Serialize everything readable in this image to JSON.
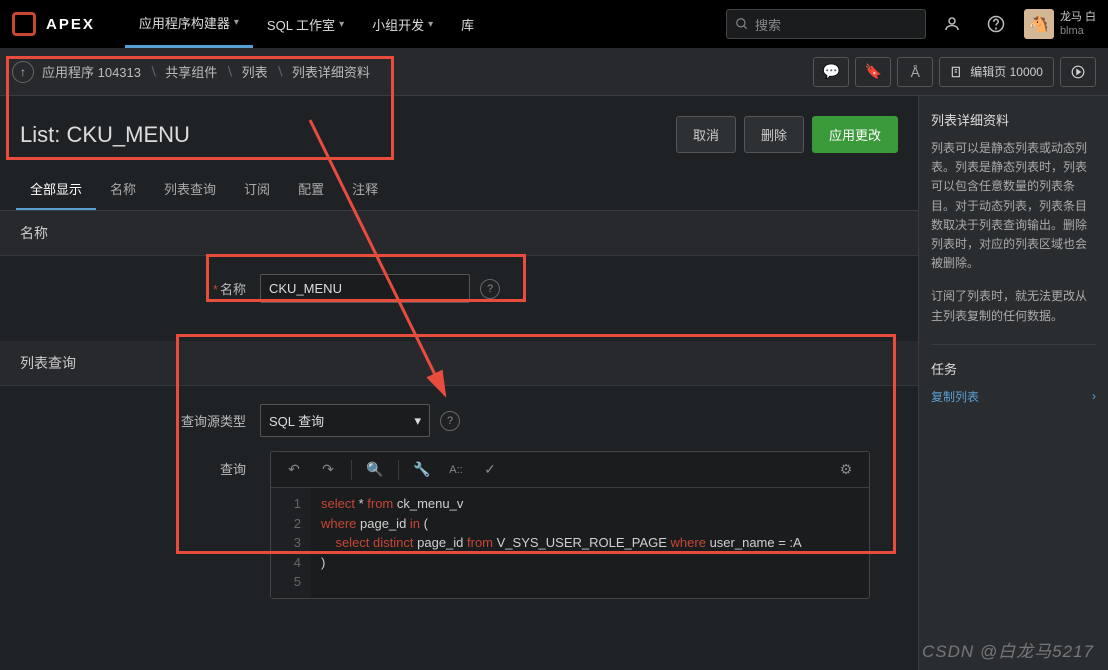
{
  "topnav": {
    "logo": "APEX",
    "items": [
      "应用程序构建器",
      "SQL 工作室",
      "小组开发",
      "库"
    ],
    "search_placeholder": "搜索",
    "user_name": "龙马 白",
    "user_id": "blma"
  },
  "breadcrumb": {
    "items": [
      "应用程序 104313",
      "共享组件",
      "列表",
      "列表详细资料"
    ]
  },
  "edit_page_btn": "编辑页 10000",
  "page_title": "List: CKU_MENU",
  "actions": {
    "cancel": "取消",
    "delete": "删除",
    "apply": "应用更改"
  },
  "tabs": [
    "全部显示",
    "名称",
    "列表查询",
    "订阅",
    "配置",
    "注释"
  ],
  "sections": {
    "name": {
      "header": "名称",
      "label": "名称",
      "value": "CKU_MENU"
    },
    "query": {
      "header": "列表查询",
      "source_type_label": "查询源类型",
      "source_type_value": "SQL 查询",
      "query_label": "查询",
      "code_lines": [
        {
          "n": 1,
          "html": "<span class='kw'>select</span> * <span class='kw'>from</span> ck_menu_v"
        },
        {
          "n": 2,
          "html": "<span class='kw'>where</span> page_id <span class='kw'>in</span> ("
        },
        {
          "n": 3,
          "html": "    <span class='kw'>select</span> <span class='kw'>distinct</span> page_id <span class='kw'>from</span> V_SYS_USER_ROLE_PAGE <span class='kw'>where</span> user_name = :A"
        },
        {
          "n": 4,
          "html": ")"
        },
        {
          "n": 5,
          "html": ""
        }
      ]
    }
  },
  "right_panel": {
    "title": "列表详细资料",
    "desc1": "列表可以是静态列表或动态列表。列表是静态列表时，列表可以包含任意数量的列表条目。对于动态列表，列表条目数取决于列表查询输出。删除列表时，对应的列表区域也会被删除。",
    "desc2": "订阅了列表时，就无法更改从主列表复制的任何数据。",
    "tasks_header": "任务",
    "task1": "复制列表"
  },
  "watermark": "CSDN @白龙马5217"
}
